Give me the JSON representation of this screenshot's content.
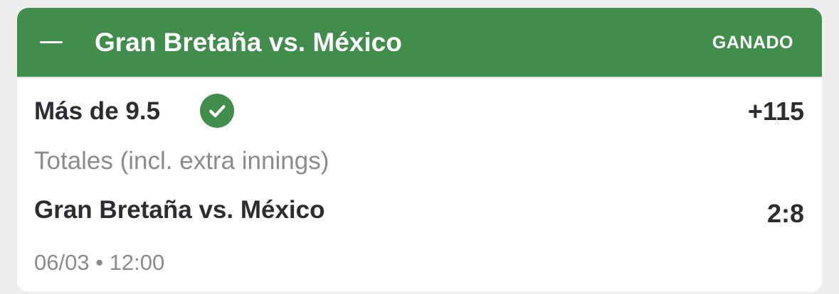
{
  "header": {
    "collapse_icon": "minus-icon",
    "title": "Gran Bretaña vs. México",
    "status": "GANADO",
    "background_color": "#418d4c"
  },
  "bet": {
    "selection": "Más de 9.5",
    "result_icon": "check-circle-icon",
    "odds": "+115",
    "market": "Totales (incl. extra innings)",
    "event": "Gran Bretaña vs. México",
    "score": "2:8",
    "datetime": "06/03 • 12:00"
  }
}
